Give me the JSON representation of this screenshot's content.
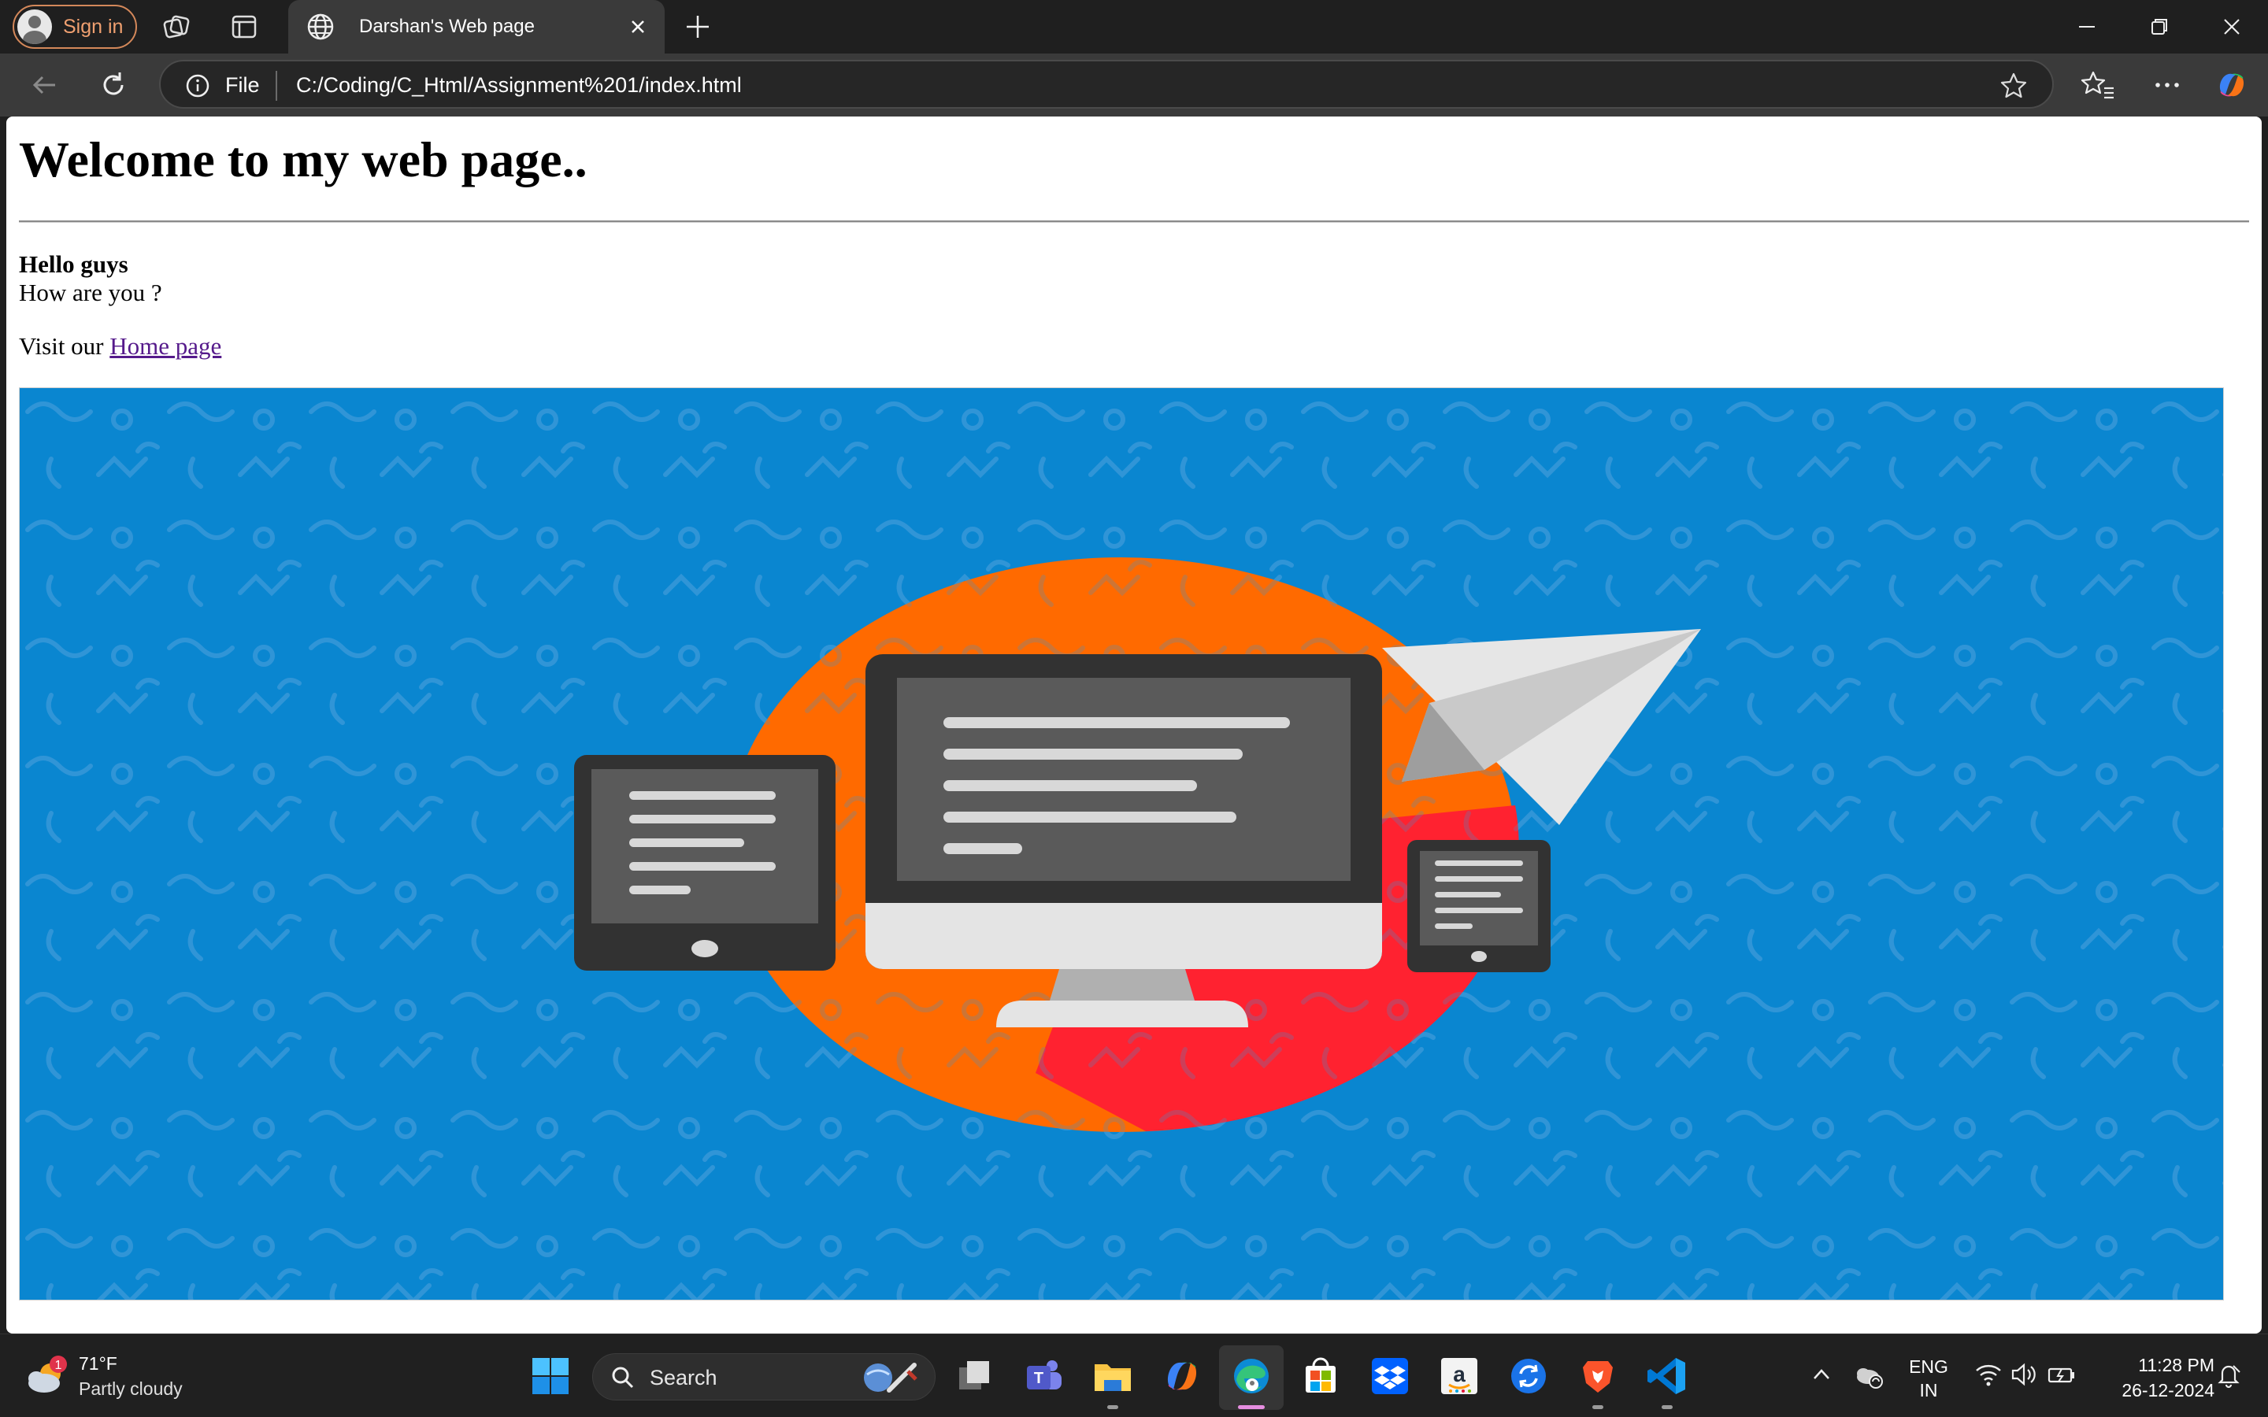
{
  "browser": {
    "signin_label": "Sign in",
    "tab_title": "Darshan's Web page",
    "address": {
      "scheme_label": "File",
      "url": "C:/Coding/C_Html/Assignment%201/index.html"
    }
  },
  "page": {
    "heading": "Welcome to my web page..",
    "greeting_bold": "Hello guys",
    "greeting_line": "How are you ?",
    "visit_prefix": "Visit our ",
    "visit_link": "Home page"
  },
  "taskbar": {
    "weather_badge": "1",
    "weather_temp": "71°F",
    "weather_desc": "Partly cloudy",
    "search_label": "Search",
    "lang_top": "ENG",
    "lang_bottom": "IN",
    "time": "11:28 PM",
    "date": "26-12-2024",
    "pinned_icons": [
      "windows-start-icon",
      "task-view-icon",
      "teams-icon",
      "file-explorer-icon",
      "copilot-icon",
      "edge-icon",
      "store-icon",
      "dropbox-icon",
      "amazon-icon",
      "sync-app-icon",
      "brave-icon",
      "vscode-icon"
    ]
  },
  "colors": {
    "hero_blue": "#0a86d0",
    "hero_orange": "#ff6a00",
    "hero_red": "#ff2230",
    "link_visited": "#551a8b",
    "signin_accent": "#f0a070"
  }
}
